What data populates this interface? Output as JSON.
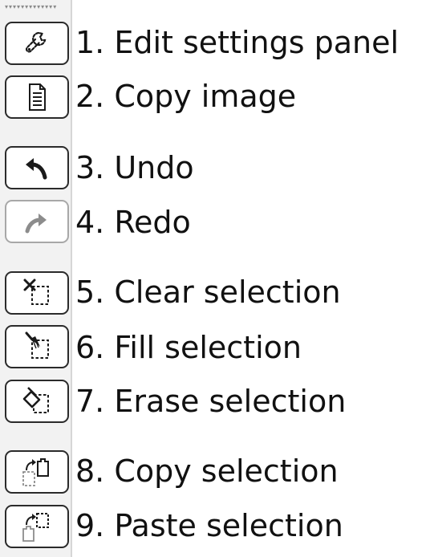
{
  "toolbar": {
    "grip": "▾▾▾▾▾▾▾▾▾▾▾▾▾",
    "buttons": [
      {
        "id": "edit-settings",
        "icon": "wrench-icon",
        "label": "1. Edit settings panel",
        "enabled": true
      },
      {
        "id": "copy-image",
        "icon": "document-icon",
        "label": "2. Copy image",
        "enabled": true
      },
      {
        "id": "undo",
        "icon": "undo-arrow-icon",
        "label": "3. Undo",
        "enabled": true
      },
      {
        "id": "redo",
        "icon": "redo-arrow-icon",
        "label": "4. Redo",
        "enabled": false
      },
      {
        "id": "clear-selection",
        "icon": "clear-selection-icon",
        "label": "5. Clear selection",
        "enabled": true
      },
      {
        "id": "fill-selection",
        "icon": "fill-selection-icon",
        "label": "6. Fill selection",
        "enabled": true
      },
      {
        "id": "erase-selection",
        "icon": "erase-selection-icon",
        "label": "7. Erase selection",
        "enabled": true
      },
      {
        "id": "copy-selection",
        "icon": "copy-selection-icon",
        "label": "8. Copy selection",
        "enabled": true
      },
      {
        "id": "paste-selection",
        "icon": "paste-selection-icon",
        "label": "9. Paste selection",
        "enabled": true
      }
    ]
  },
  "colors": {
    "icon": "#1a1a1a",
    "icon_disabled": "#8c8c8c",
    "border": "#2b2b2b",
    "border_disabled": "#a8a8a8"
  }
}
